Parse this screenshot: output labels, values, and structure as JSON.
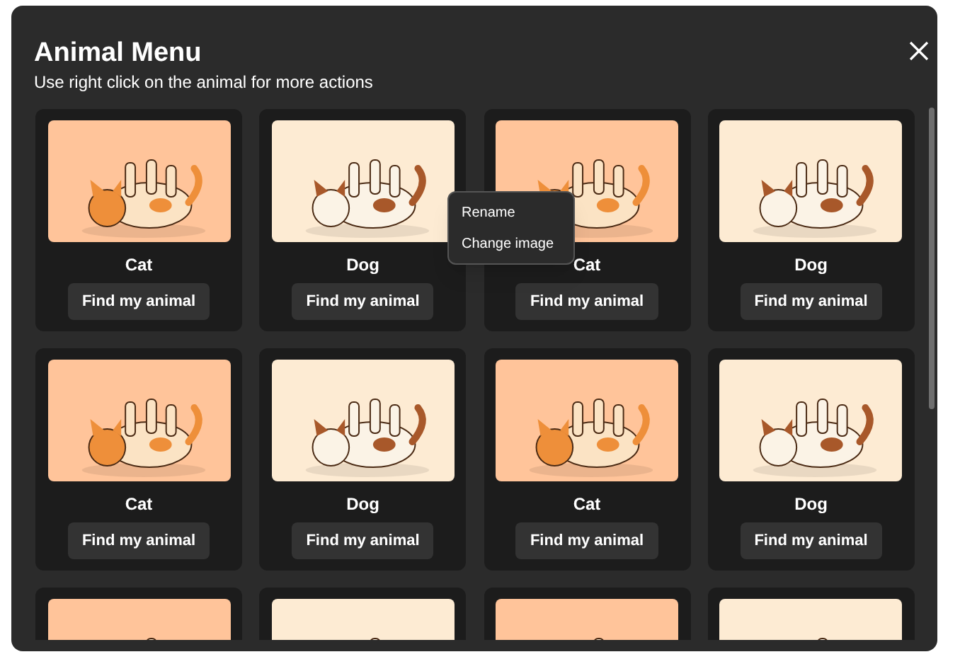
{
  "dialog": {
    "title": "Animal Menu",
    "subtitle": "Use right click on the animal for more actions"
  },
  "cards": [
    {
      "kind": "cat",
      "name": "Cat",
      "button": "Find my animal"
    },
    {
      "kind": "dog",
      "name": "Dog",
      "button": "Find my animal"
    },
    {
      "kind": "cat",
      "name": "Cat",
      "button": "Find my animal"
    },
    {
      "kind": "dog",
      "name": "Dog",
      "button": "Find my animal"
    },
    {
      "kind": "cat",
      "name": "Cat",
      "button": "Find my animal"
    },
    {
      "kind": "dog",
      "name": "Dog",
      "button": "Find my animal"
    },
    {
      "kind": "cat",
      "name": "Cat",
      "button": "Find my animal"
    },
    {
      "kind": "dog",
      "name": "Dog",
      "button": "Find my animal"
    },
    {
      "kind": "cat"
    },
    {
      "kind": "dog"
    },
    {
      "kind": "cat"
    },
    {
      "kind": "dog"
    }
  ],
  "context_menu": {
    "items": [
      "Rename",
      "Change image"
    ]
  }
}
